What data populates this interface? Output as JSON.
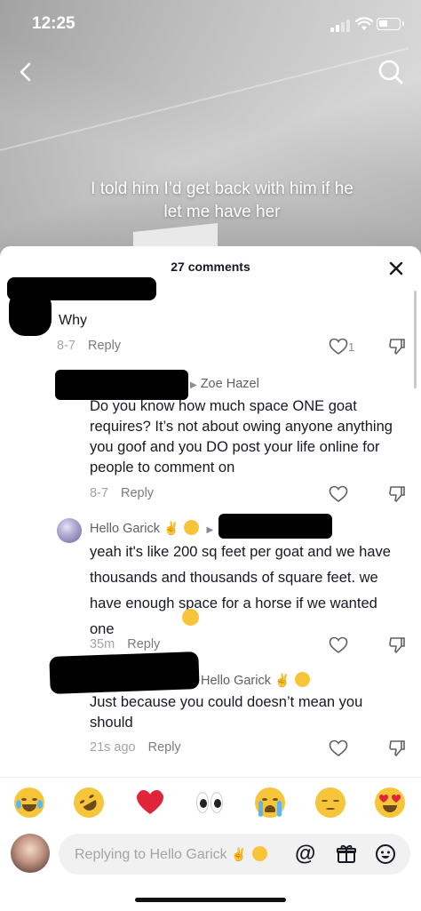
{
  "status": {
    "time": "12:25"
  },
  "video": {
    "caption": "I told him I’d get back with him if he let me have her"
  },
  "sheet": {
    "title": "27 comments"
  },
  "comments": [
    {
      "text": "Why",
      "date": "8-7",
      "reply_label": "Reply",
      "likes": "1"
    },
    {
      "reply_to": "Zoe Hazel",
      "text": "Do you know how much space ONE goat requires? It’s not about owing anyone anything you goof and you DO post your life online for people to comment on",
      "date": "8-7",
      "reply_label": "Reply"
    },
    {
      "username": "Hello Garick",
      "text": "yeah it's like 200 sq feet per goat and we have thousands and thousands of square feet. we have enough space for a horse if we wanted one",
      "date": "35m",
      "reply_label": "Reply"
    },
    {
      "reply_to": "Hello Garick",
      "text": "Just because you could doesn’t mean you should",
      "date": "21s ago",
      "reply_label": "Reply"
    }
  ],
  "input": {
    "placeholder": "Replying to Hello Garick",
    "mention_symbol": "@"
  },
  "emoji_bar": [
    "face-with-tears-of-joy",
    "rolling-on-floor-laughing",
    "red-heart",
    "eyes",
    "loudly-crying-face",
    "pensive-face",
    "heart-eyes-face"
  ],
  "colors": {
    "text": "#161823",
    "muted": "#8a8b91",
    "heart": "#e0243a",
    "emoji_yellow": "#f7c53a"
  }
}
